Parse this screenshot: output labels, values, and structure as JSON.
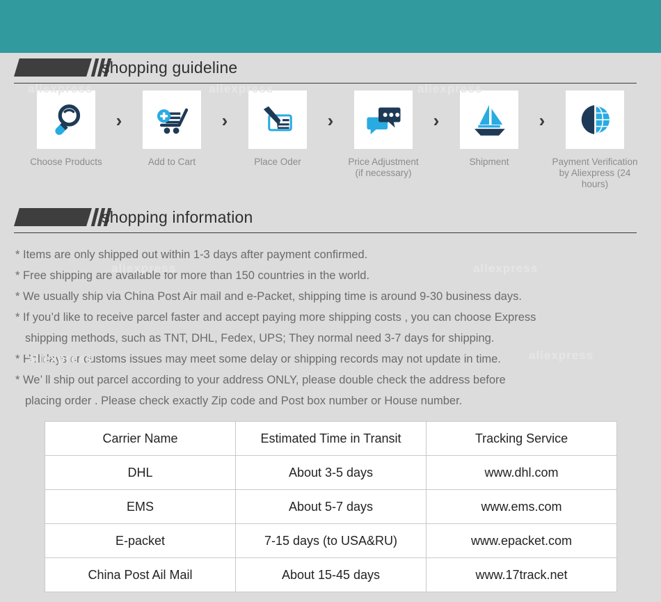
{
  "banner": {
    "color": "#309a9f"
  },
  "background": {
    "color": "#dcdcdc"
  },
  "watermark_text": "aliexpress",
  "guideline": {
    "title": "shopping guideline",
    "arrow": "›",
    "steps": [
      {
        "icon": "magnifier-icon",
        "label": "Choose Products"
      },
      {
        "icon": "add-to-cart-icon",
        "label": "Add to Cart"
      },
      {
        "icon": "pen-order-icon",
        "label": "Place Oder"
      },
      {
        "icon": "chat-bubbles-icon",
        "label": "Price Adjustment\n(if necessary)"
      },
      {
        "icon": "sailboat-icon",
        "label": "Shipment"
      },
      {
        "icon": "dollar-globe-icon",
        "label": "Payment Verification\nby  Aliexpress (24 hours)"
      }
    ]
  },
  "information": {
    "title": "shopping information",
    "lines": [
      {
        "text": "* Items are only shipped out within 1-3 days after payment confirmed.",
        "indent": false
      },
      {
        "text": "* Free shipping are available for more than 150 countries in the world.",
        "indent": false
      },
      {
        "text": "* We usually ship via China Post Air mail and e-Packet, shipping time is around 9-30 business days.",
        "indent": false
      },
      {
        "text": "* If you’d like to receive parcel faster and accept paying more shipping costs , you can choose Express",
        "indent": false
      },
      {
        "text": "shipping methods, such as TNT, DHL, Fedex, UPS; They normal need 3-7 days for shipping.",
        "indent": true
      },
      {
        "text": "* Holidays or customs issues may meet some delay or shipping records may not update in time.",
        "indent": false
      },
      {
        "text": "* We’ ll ship out parcel according to your address ONLY, please double check the address before",
        "indent": false
      },
      {
        "text": "placing order . Please check exactly Zip code and Post box number or House number.",
        "indent": true
      }
    ]
  },
  "carrier_table": {
    "headers": [
      "Carrier Name",
      "Estimated Time in Transit",
      "Tracking Service"
    ],
    "rows": [
      [
        "DHL",
        "About 3-5 days",
        "www.dhl.com"
      ],
      [
        "EMS",
        "About 5-7 days",
        "www.ems.com"
      ],
      [
        "E-packet",
        "7-15 days (to USA&RU)",
        "www.epacket.com"
      ],
      [
        "China Post Ail Mail",
        "About 15-45 days",
        "www.17track.net"
      ]
    ]
  }
}
